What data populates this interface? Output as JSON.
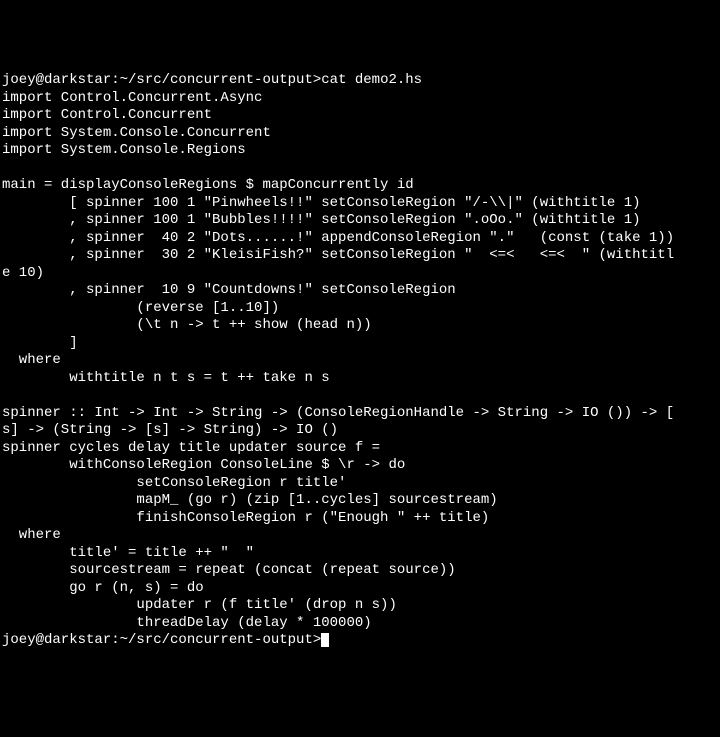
{
  "terminal": {
    "prompt1": "joey@darkstar:~/src/concurrent-output>",
    "command1": "cat demo2.hs",
    "lines": [
      "import Control.Concurrent.Async",
      "import Control.Concurrent",
      "import System.Console.Concurrent",
      "import System.Console.Regions",
      "",
      "main = displayConsoleRegions $ mapConcurrently id",
      "        [ spinner 100 1 \"Pinwheels!!\" setConsoleRegion \"/-\\\\|\" (withtitle 1)",
      "        , spinner 100 1 \"Bubbles!!!!\" setConsoleRegion \".oOo.\" (withtitle 1)",
      "        , spinner  40 2 \"Dots......!\" appendConsoleRegion \".\"   (const (take 1))",
      "        , spinner  30 2 \"KleisiFish?\" setConsoleRegion \"  <=<   <=<  \" (withtitl",
      "e 10)",
      "        , spinner  10 9 \"Countdowns!\" setConsoleRegion",
      "                (reverse [1..10])",
      "                (\\t n -> t ++ show (head n))",
      "        ]",
      "  where",
      "        withtitle n t s = t ++ take n s",
      "",
      "spinner :: Int -> Int -> String -> (ConsoleRegionHandle -> String -> IO ()) -> [",
      "s] -> (String -> [s] -> String) -> IO ()",
      "spinner cycles delay title updater source f =",
      "        withConsoleRegion ConsoleLine $ \\r -> do",
      "                setConsoleRegion r title'",
      "                mapM_ (go r) (zip [1..cycles] sourcestream)",
      "                finishConsoleRegion r (\"Enough \" ++ title)",
      "  where",
      "        title' = title ++ \"  \"",
      "        sourcestream = repeat (concat (repeat source))",
      "        go r (n, s) = do",
      "                updater r (f title' (drop n s))",
      "                threadDelay (delay * 100000)"
    ],
    "prompt2": "joey@darkstar:~/src/concurrent-output>"
  }
}
